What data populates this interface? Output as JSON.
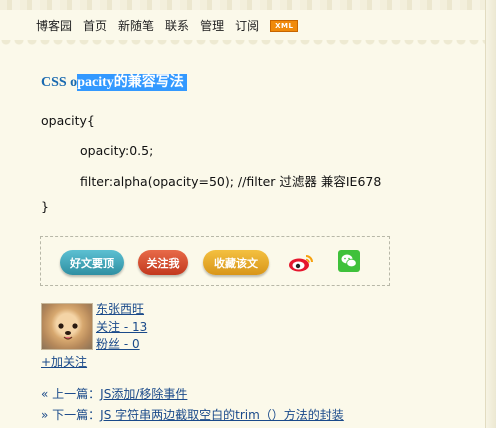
{
  "nav": {
    "items": [
      "博客园",
      "首页",
      "新随笔",
      "联系",
      "管理",
      "订阅"
    ],
    "xml_badge": "XML"
  },
  "post": {
    "title_prefix": "CSS o",
    "title_selected": "pacity的兼容写法",
    "code_lines": [
      "opacity{",
      "opacity:0.5;",
      "filter:alpha(opacity=50);  //filter 过滤器   兼容IE678",
      "}"
    ]
  },
  "share": {
    "buttons": [
      {
        "label": "好文要顶",
        "color": "#3a9fb1"
      },
      {
        "label": "关注我",
        "color": "#d0452a"
      },
      {
        "label": "收藏该文",
        "color": "#e0a020"
      }
    ],
    "icons": [
      "weibo-icon",
      "wechat-icon"
    ]
  },
  "author": {
    "name": "东张西旺",
    "following": "关注 - 13",
    "followers": "粉丝 - 0",
    "follow_link": "+加关注"
  },
  "post_nav": {
    "prev_label": "« 上一篇：",
    "prev_link": "JS添加/移除事件",
    "next_label": "» 下一篇：",
    "next_link": "JS 字符串两边截取空白的trim（）方法的封装"
  }
}
